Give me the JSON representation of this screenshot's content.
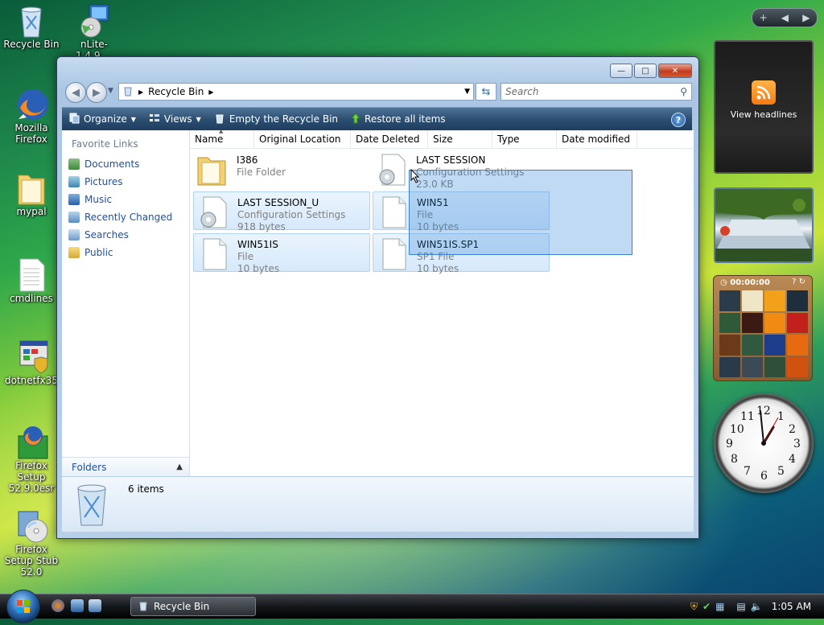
{
  "desktop": {
    "icons": [
      {
        "label": "Recycle Bin"
      },
      {
        "label": "nLite-1.4.9...."
      },
      {
        "label": "Mozilla Firefox"
      },
      {
        "label": "mypal"
      },
      {
        "label": "cmdlines"
      },
      {
        "label": "dotnetfx35"
      },
      {
        "label": "Firefox Setup 52.9.0esr"
      },
      {
        "label": "Firefox Setup Stub 52.0"
      }
    ]
  },
  "window": {
    "address": {
      "location": "Recycle Bin"
    },
    "search": {
      "placeholder": "Search"
    },
    "toolbar": {
      "organize": "Organize",
      "views": "Views",
      "empty": "Empty the Recycle Bin",
      "restore": "Restore all items"
    },
    "nav": {
      "favorites_title": "Favorite Links",
      "links": [
        "Documents",
        "Pictures",
        "Music",
        "Recently Changed",
        "Searches",
        "Public"
      ],
      "folders_label": "Folders"
    },
    "columns": [
      "Name",
      "Original Location",
      "Date Deleted",
      "Size",
      "Type",
      "Date modified"
    ],
    "items": [
      {
        "name": "I386",
        "type": "File Folder",
        "size": ""
      },
      {
        "name": "LAST SESSION",
        "type": "Configuration Settings",
        "size": "23.0 KB"
      },
      {
        "name": "LAST SESSION_U",
        "type": "Configuration Settings",
        "size": "918 bytes"
      },
      {
        "name": "WIN51",
        "type": "File",
        "size": "10 bytes"
      },
      {
        "name": "WIN51IS",
        "type": "File",
        "size": "10 bytes"
      },
      {
        "name": "WIN51IS.SP1",
        "type": "SP1 File",
        "size": "10 bytes"
      }
    ],
    "details": {
      "count": "6 items"
    }
  },
  "gadgets": {
    "feed": {
      "label": "View headlines"
    },
    "puzzle": {
      "timer": "00:00:00"
    },
    "clock": {
      "numbers": [
        "12",
        "1",
        "2",
        "3",
        "4",
        "5",
        "6",
        "7",
        "8",
        "9",
        "10",
        "11"
      ]
    }
  },
  "taskbar": {
    "window_button": "Recycle Bin",
    "clock": "1:05 AM"
  },
  "colors": {
    "accent": "#2d4f72",
    "selection": "#3385d6"
  }
}
